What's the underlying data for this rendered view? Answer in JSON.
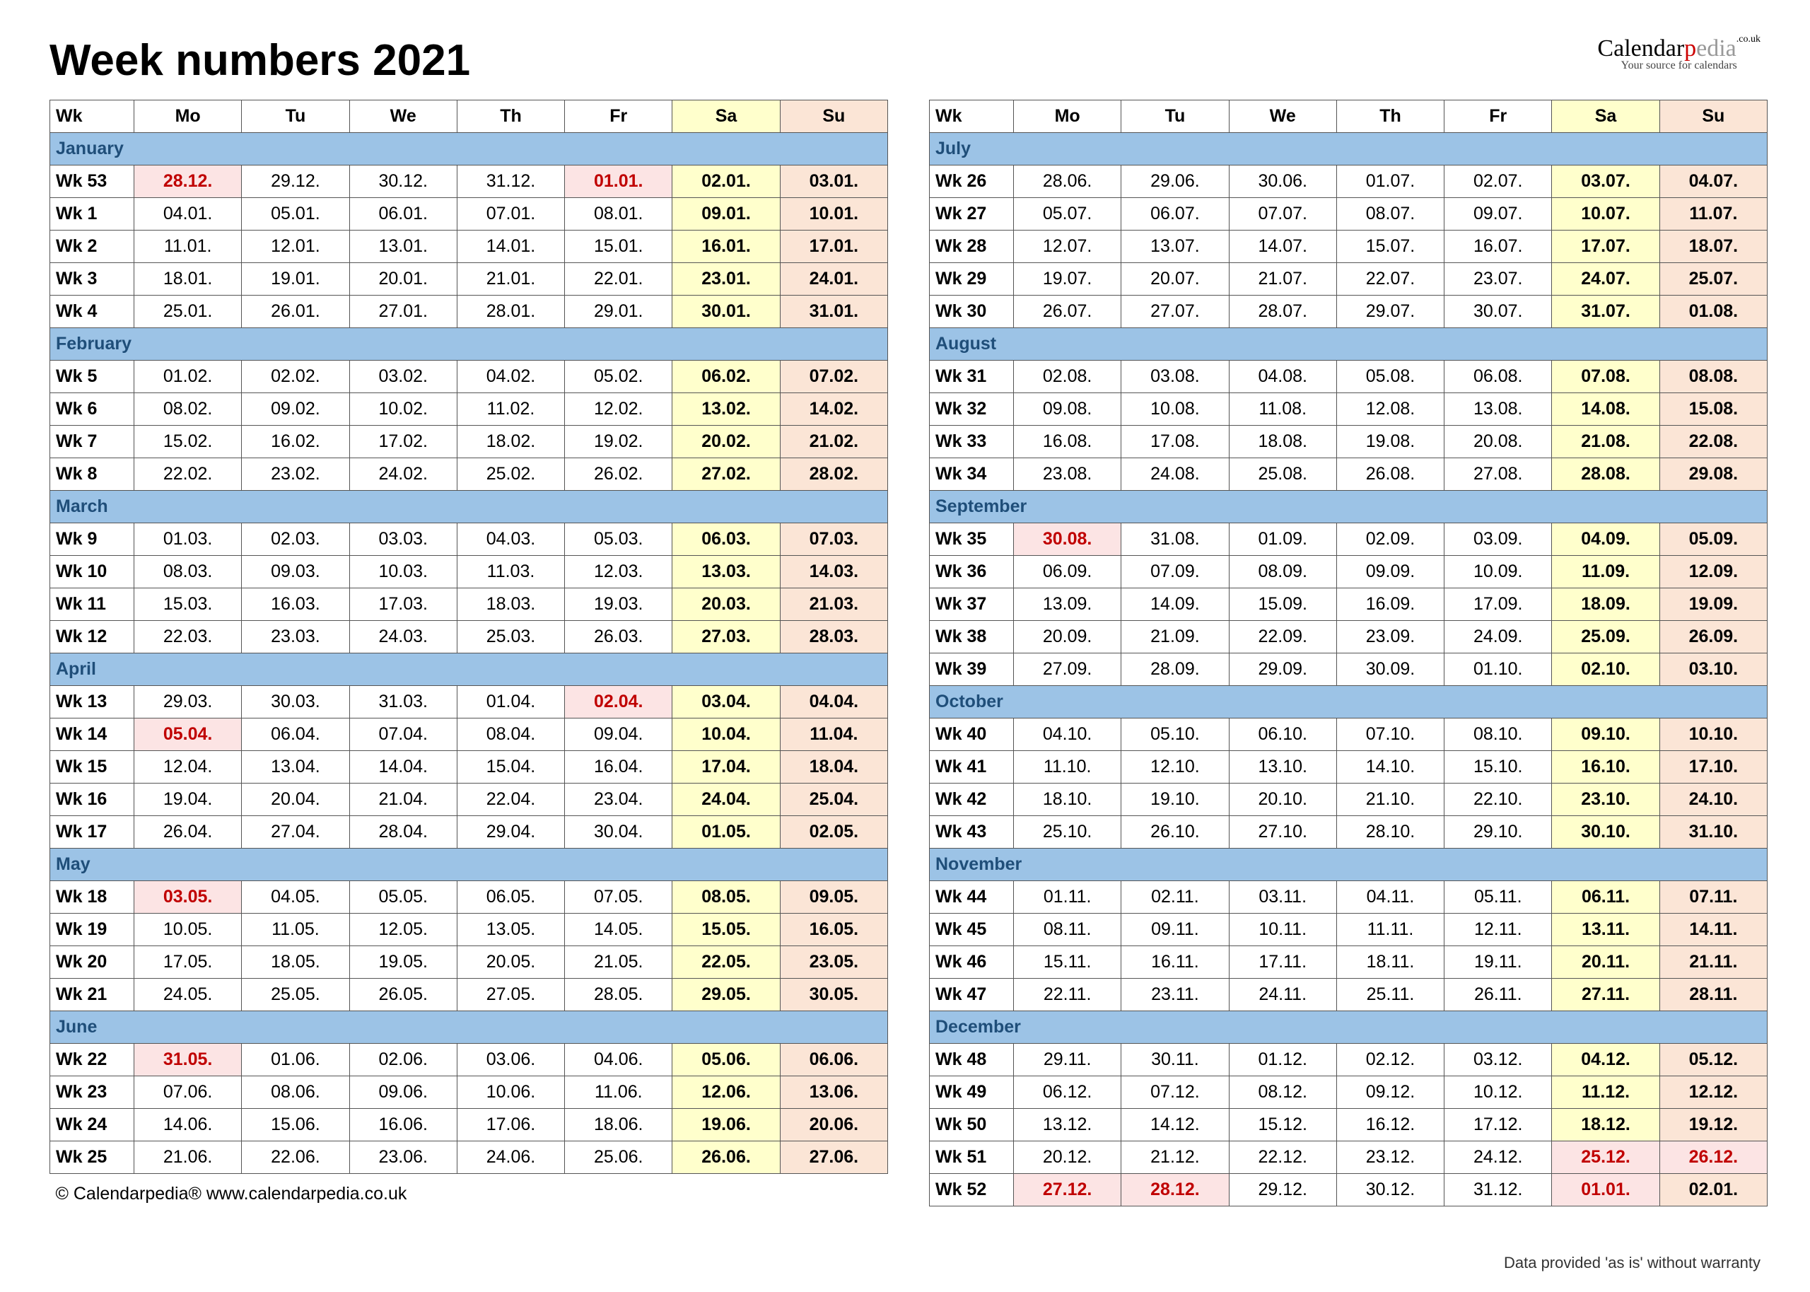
{
  "title": "Week numbers 2021",
  "brand": {
    "l1a": "Calendar",
    "l1b": "p",
    "l1c": "edia",
    "uk": ".co.uk",
    "tag": "Your source for calendars"
  },
  "hdr": [
    "Wk",
    "Mo",
    "Tu",
    "We",
    "Th",
    "Fr",
    "Sa",
    "Su"
  ],
  "footer": "© Calendarpedia®    www.calendarpedia.co.uk",
  "disclaimer": "Data provided 'as is' without warranty",
  "left": [
    {
      "m": "January",
      "r": [
        [
          "Wk 53",
          "28.12.",
          "29.12.",
          "30.12.",
          "31.12.",
          "01.01.",
          "02.01.",
          "03.01."
        ],
        [
          "Wk 1",
          "04.01.",
          "05.01.",
          "06.01.",
          "07.01.",
          "08.01.",
          "09.01.",
          "10.01."
        ],
        [
          "Wk 2",
          "11.01.",
          "12.01.",
          "13.01.",
          "14.01.",
          "15.01.",
          "16.01.",
          "17.01."
        ],
        [
          "Wk 3",
          "18.01.",
          "19.01.",
          "20.01.",
          "21.01.",
          "22.01.",
          "23.01.",
          "24.01."
        ],
        [
          "Wk 4",
          "25.01.",
          "26.01.",
          "27.01.",
          "28.01.",
          "29.01.",
          "30.01.",
          "31.01."
        ]
      ],
      "hol": [
        [
          0,
          1
        ],
        [
          0,
          5
        ]
      ]
    },
    {
      "m": "February",
      "r": [
        [
          "Wk 5",
          "01.02.",
          "02.02.",
          "03.02.",
          "04.02.",
          "05.02.",
          "06.02.",
          "07.02."
        ],
        [
          "Wk 6",
          "08.02.",
          "09.02.",
          "10.02.",
          "11.02.",
          "12.02.",
          "13.02.",
          "14.02."
        ],
        [
          "Wk 7",
          "15.02.",
          "16.02.",
          "17.02.",
          "18.02.",
          "19.02.",
          "20.02.",
          "21.02."
        ],
        [
          "Wk 8",
          "22.02.",
          "23.02.",
          "24.02.",
          "25.02.",
          "26.02.",
          "27.02.",
          "28.02."
        ]
      ]
    },
    {
      "m": "March",
      "r": [
        [
          "Wk 9",
          "01.03.",
          "02.03.",
          "03.03.",
          "04.03.",
          "05.03.",
          "06.03.",
          "07.03."
        ],
        [
          "Wk 10",
          "08.03.",
          "09.03.",
          "10.03.",
          "11.03.",
          "12.03.",
          "13.03.",
          "14.03."
        ],
        [
          "Wk 11",
          "15.03.",
          "16.03.",
          "17.03.",
          "18.03.",
          "19.03.",
          "20.03.",
          "21.03."
        ],
        [
          "Wk 12",
          "22.03.",
          "23.03.",
          "24.03.",
          "25.03.",
          "26.03.",
          "27.03.",
          "28.03."
        ]
      ]
    },
    {
      "m": "April",
      "r": [
        [
          "Wk 13",
          "29.03.",
          "30.03.",
          "31.03.",
          "01.04.",
          "02.04.",
          "03.04.",
          "04.04."
        ],
        [
          "Wk 14",
          "05.04.",
          "06.04.",
          "07.04.",
          "08.04.",
          "09.04.",
          "10.04.",
          "11.04."
        ],
        [
          "Wk 15",
          "12.04.",
          "13.04.",
          "14.04.",
          "15.04.",
          "16.04.",
          "17.04.",
          "18.04."
        ],
        [
          "Wk 16",
          "19.04.",
          "20.04.",
          "21.04.",
          "22.04.",
          "23.04.",
          "24.04.",
          "25.04."
        ],
        [
          "Wk 17",
          "26.04.",
          "27.04.",
          "28.04.",
          "29.04.",
          "30.04.",
          "01.05.",
          "02.05."
        ]
      ],
      "hol": [
        [
          0,
          5
        ],
        [
          1,
          1
        ]
      ]
    },
    {
      "m": "May",
      "r": [
        [
          "Wk 18",
          "03.05.",
          "04.05.",
          "05.05.",
          "06.05.",
          "07.05.",
          "08.05.",
          "09.05."
        ],
        [
          "Wk 19",
          "10.05.",
          "11.05.",
          "12.05.",
          "13.05.",
          "14.05.",
          "15.05.",
          "16.05."
        ],
        [
          "Wk 20",
          "17.05.",
          "18.05.",
          "19.05.",
          "20.05.",
          "21.05.",
          "22.05.",
          "23.05."
        ],
        [
          "Wk 21",
          "24.05.",
          "25.05.",
          "26.05.",
          "27.05.",
          "28.05.",
          "29.05.",
          "30.05."
        ]
      ],
      "hol": [
        [
          0,
          1
        ]
      ]
    },
    {
      "m": "June",
      "r": [
        [
          "Wk 22",
          "31.05.",
          "01.06.",
          "02.06.",
          "03.06.",
          "04.06.",
          "05.06.",
          "06.06."
        ],
        [
          "Wk 23",
          "07.06.",
          "08.06.",
          "09.06.",
          "10.06.",
          "11.06.",
          "12.06.",
          "13.06."
        ],
        [
          "Wk 24",
          "14.06.",
          "15.06.",
          "16.06.",
          "17.06.",
          "18.06.",
          "19.06.",
          "20.06."
        ],
        [
          "Wk 25",
          "21.06.",
          "22.06.",
          "23.06.",
          "24.06.",
          "25.06.",
          "26.06.",
          "27.06."
        ]
      ],
      "hol": [
        [
          0,
          1
        ]
      ]
    }
  ],
  "right": [
    {
      "m": "July",
      "r": [
        [
          "Wk 26",
          "28.06.",
          "29.06.",
          "30.06.",
          "01.07.",
          "02.07.",
          "03.07.",
          "04.07."
        ],
        [
          "Wk 27",
          "05.07.",
          "06.07.",
          "07.07.",
          "08.07.",
          "09.07.",
          "10.07.",
          "11.07."
        ],
        [
          "Wk 28",
          "12.07.",
          "13.07.",
          "14.07.",
          "15.07.",
          "16.07.",
          "17.07.",
          "18.07."
        ],
        [
          "Wk 29",
          "19.07.",
          "20.07.",
          "21.07.",
          "22.07.",
          "23.07.",
          "24.07.",
          "25.07."
        ],
        [
          "Wk 30",
          "26.07.",
          "27.07.",
          "28.07.",
          "29.07.",
          "30.07.",
          "31.07.",
          "01.08."
        ]
      ]
    },
    {
      "m": "August",
      "r": [
        [
          "Wk 31",
          "02.08.",
          "03.08.",
          "04.08.",
          "05.08.",
          "06.08.",
          "07.08.",
          "08.08."
        ],
        [
          "Wk 32",
          "09.08.",
          "10.08.",
          "11.08.",
          "12.08.",
          "13.08.",
          "14.08.",
          "15.08."
        ],
        [
          "Wk 33",
          "16.08.",
          "17.08.",
          "18.08.",
          "19.08.",
          "20.08.",
          "21.08.",
          "22.08."
        ],
        [
          "Wk 34",
          "23.08.",
          "24.08.",
          "25.08.",
          "26.08.",
          "27.08.",
          "28.08.",
          "29.08."
        ]
      ]
    },
    {
      "m": "September",
      "r": [
        [
          "Wk 35",
          "30.08.",
          "31.08.",
          "01.09.",
          "02.09.",
          "03.09.",
          "04.09.",
          "05.09."
        ],
        [
          "Wk 36",
          "06.09.",
          "07.09.",
          "08.09.",
          "09.09.",
          "10.09.",
          "11.09.",
          "12.09."
        ],
        [
          "Wk 37",
          "13.09.",
          "14.09.",
          "15.09.",
          "16.09.",
          "17.09.",
          "18.09.",
          "19.09."
        ],
        [
          "Wk 38",
          "20.09.",
          "21.09.",
          "22.09.",
          "23.09.",
          "24.09.",
          "25.09.",
          "26.09."
        ],
        [
          "Wk 39",
          "27.09.",
          "28.09.",
          "29.09.",
          "30.09.",
          "01.10.",
          "02.10.",
          "03.10."
        ]
      ],
      "hol": [
        [
          0,
          1
        ]
      ]
    },
    {
      "m": "October",
      "r": [
        [
          "Wk 40",
          "04.10.",
          "05.10.",
          "06.10.",
          "07.10.",
          "08.10.",
          "09.10.",
          "10.10."
        ],
        [
          "Wk 41",
          "11.10.",
          "12.10.",
          "13.10.",
          "14.10.",
          "15.10.",
          "16.10.",
          "17.10."
        ],
        [
          "Wk 42",
          "18.10.",
          "19.10.",
          "20.10.",
          "21.10.",
          "22.10.",
          "23.10.",
          "24.10."
        ],
        [
          "Wk 43",
          "25.10.",
          "26.10.",
          "27.10.",
          "28.10.",
          "29.10.",
          "30.10.",
          "31.10."
        ]
      ]
    },
    {
      "m": "November",
      "r": [
        [
          "Wk 44",
          "01.11.",
          "02.11.",
          "03.11.",
          "04.11.",
          "05.11.",
          "06.11.",
          "07.11."
        ],
        [
          "Wk 45",
          "08.11.",
          "09.11.",
          "10.11.",
          "11.11.",
          "12.11.",
          "13.11.",
          "14.11."
        ],
        [
          "Wk 46",
          "15.11.",
          "16.11.",
          "17.11.",
          "18.11.",
          "19.11.",
          "20.11.",
          "21.11."
        ],
        [
          "Wk 47",
          "22.11.",
          "23.11.",
          "24.11.",
          "25.11.",
          "26.11.",
          "27.11.",
          "28.11."
        ]
      ]
    },
    {
      "m": "December",
      "r": [
        [
          "Wk 48",
          "29.11.",
          "30.11.",
          "01.12.",
          "02.12.",
          "03.12.",
          "04.12.",
          "05.12."
        ],
        [
          "Wk 49",
          "06.12.",
          "07.12.",
          "08.12.",
          "09.12.",
          "10.12.",
          "11.12.",
          "12.12."
        ],
        [
          "Wk 50",
          "13.12.",
          "14.12.",
          "15.12.",
          "16.12.",
          "17.12.",
          "18.12.",
          "19.12."
        ],
        [
          "Wk 51",
          "20.12.",
          "21.12.",
          "22.12.",
          "23.12.",
          "24.12.",
          "25.12.",
          "26.12."
        ],
        [
          "Wk 52",
          "27.12.",
          "28.12.",
          "29.12.",
          "30.12.",
          "31.12.",
          "01.01.",
          "02.01."
        ]
      ],
      "hol": [
        [
          3,
          6
        ],
        [
          3,
          7
        ],
        [
          4,
          1
        ],
        [
          4,
          2
        ],
        [
          4,
          6
        ]
      ]
    }
  ]
}
